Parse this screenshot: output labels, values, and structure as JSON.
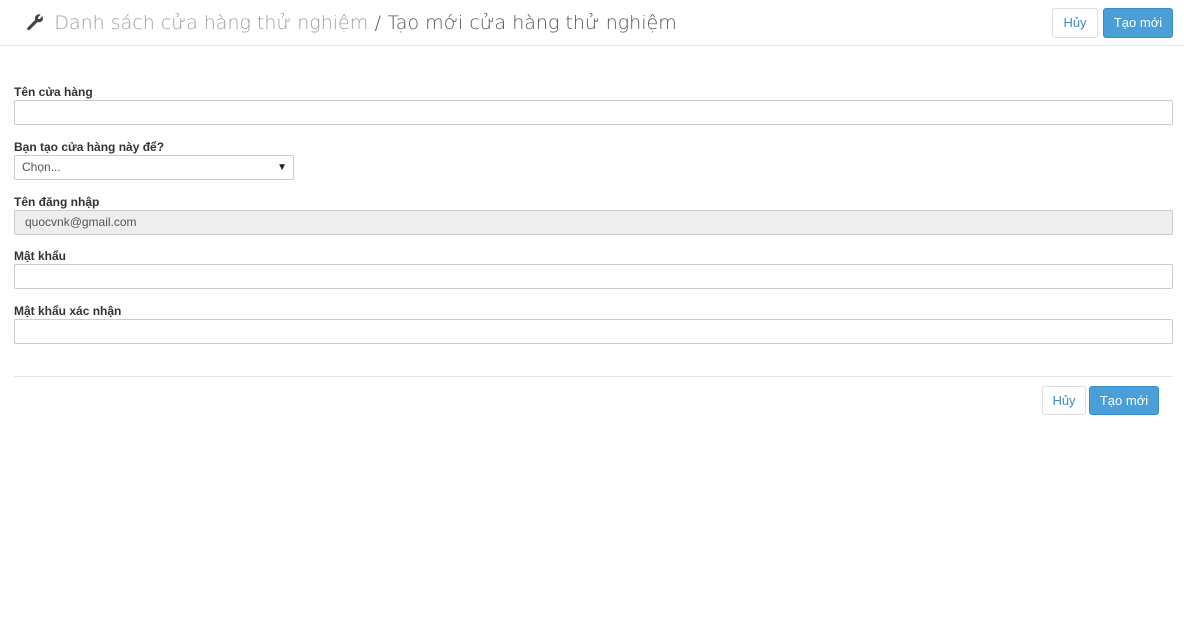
{
  "header": {
    "breadcrumb_parent": "Danh sách cửa hàng thử nghiệm",
    "breadcrumb_separator": "/",
    "breadcrumb_current": "Tạo mới cửa hàng thử nghiệm",
    "icon": "wrench-icon",
    "cancel_label": "Hủy",
    "create_label": "Tạo mới"
  },
  "form": {
    "store_name": {
      "label": "Tên cửa hàng",
      "value": ""
    },
    "purpose": {
      "label": "Bạn tạo cửa hàng này để?",
      "selected": "Chọn..."
    },
    "username": {
      "label": "Tên đăng nhập",
      "value": "quocvnk@gmail.com"
    },
    "password": {
      "label": "Mật khẩu",
      "value": ""
    },
    "password_confirm": {
      "label": "Mật khẩu xác nhận",
      "value": ""
    }
  },
  "footer": {
    "cancel_label": "Hủy",
    "create_label": "Tạo mới"
  },
  "colors": {
    "primary": "#4a9fd8",
    "link": "#428bca",
    "readonly_bg": "#eeeeee"
  }
}
